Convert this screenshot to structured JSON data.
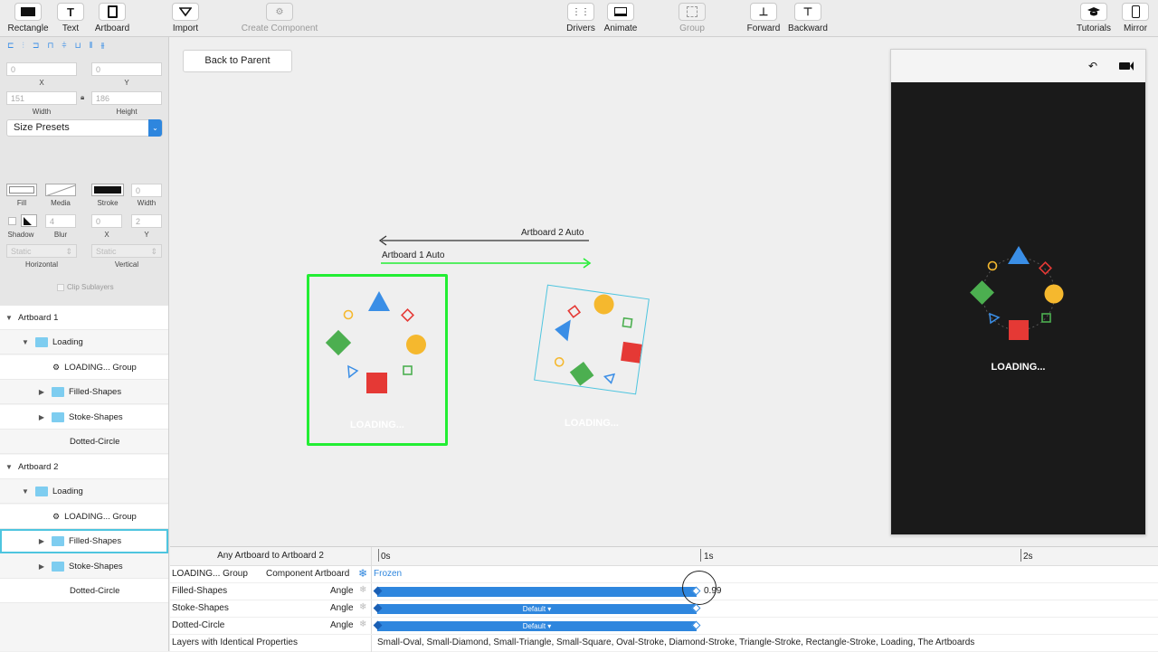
{
  "toolbar": {
    "rectangle": "Rectangle",
    "text": "Text",
    "artboard": "Artboard",
    "import": "Import",
    "create_component": "Create Component",
    "drivers": "Drivers",
    "animate": "Animate",
    "group": "Group",
    "forward": "Forward",
    "backward": "Backward",
    "tutorials": "Tutorials",
    "mirror": "Mirror"
  },
  "inspector": {
    "x_value": "0",
    "x_label": "X",
    "y_value": "0",
    "y_label": "Y",
    "width_value": "151",
    "width_label": "Width",
    "height_value": "186",
    "height_label": "Height",
    "size_presets": "Size Presets",
    "fill_label": "Fill",
    "media_label": "Media",
    "stroke_label": "Stroke",
    "stroke_width_value": "0",
    "stroke_width_label": "Width",
    "shadow_label": "Shadow",
    "blur_value": "4",
    "blur_label": "Blur",
    "shadow_x_value": "0",
    "shadow_x_label": "X",
    "shadow_y_value": "2",
    "shadow_y_label": "Y",
    "horizontal_value": "Static",
    "horizontal_label": "Horizontal",
    "vertical_value": "Static",
    "vertical_label": "Vertical",
    "clip_sublayers": "Clip Sublayers"
  },
  "layers": {
    "artboard1": "Artboard 1",
    "artboard2": "Artboard 2",
    "loading": "Loading",
    "loading_group": "LOADING... Group",
    "filled_shapes": "Filled-Shapes",
    "stoke_shapes": "Stoke-Shapes",
    "dotted_circle": "Dotted-Circle"
  },
  "canvas": {
    "back_to_parent": "Back to Parent",
    "arrow_top_label": "Artboard 2 Auto",
    "arrow_bottom_label": "Artboard 1 Auto",
    "loading_text": "LOADING..."
  },
  "preview": {
    "loading_text": "LOADING..."
  },
  "timeline": {
    "transition": "Any Artboard to Artboard 2",
    "tick_0": "0s",
    "tick_1": "1s",
    "tick_2": "2s",
    "row1_layer": "LOADING... Group",
    "row1_prop": "Component Artboard",
    "row1_value": "Frozen",
    "row2_layer": "Filled-Shapes",
    "row2_prop": "Angle",
    "row2_value": "0.99",
    "row3_layer": "Stoke-Shapes",
    "row3_prop": "Angle",
    "row3_curve": "Default ▾",
    "row4_layer": "Dotted-Circle",
    "row4_prop": "Angle",
    "row4_curve": "Default ▾",
    "identical_label": "Layers with Identical Properties",
    "identical_list": "Small-Oval, Small-Diamond, Small-Triangle, Small-Square, Oval-Stroke, Diamond-Stroke, Triangle-Stroke, Rectangle-Stroke, Loading, The Artboards"
  },
  "colors": {
    "accent": "#2e86de",
    "selection_green": "#22ee33",
    "selection_cyan": "#4ec5df",
    "blue_shape": "#3a8ee6",
    "yellow_shape": "#f5b82e",
    "green_shape": "#4caf50",
    "red_shape": "#e53935"
  }
}
